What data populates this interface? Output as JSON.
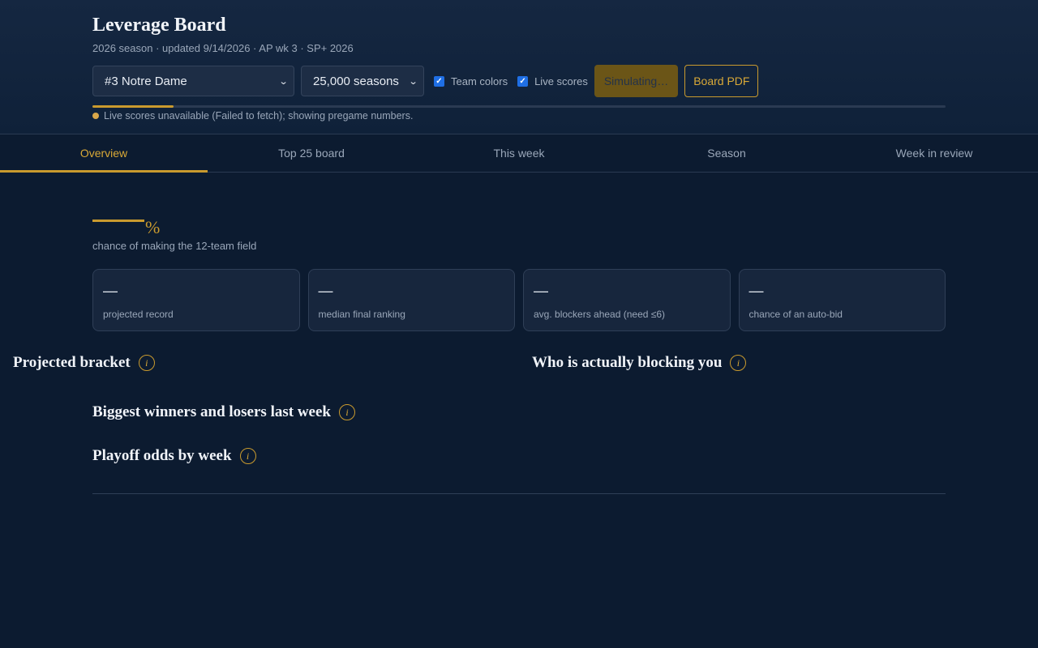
{
  "header": {
    "title": "Leverage Board",
    "subtitle": "2026 season · updated 9/14/2026 · AP wk 3 · SP+ 2026"
  },
  "controls": {
    "team_select": "#3 Notre Dame",
    "seasons_select": "25,000 seasons",
    "team_colors_label": "Team colors",
    "team_colors_checked": true,
    "live_scores_label": "Live scores",
    "live_scores_checked": true,
    "simulate_label": "Simulating…",
    "pdf_label": "Board PDF",
    "progress_fraction": 0.095
  },
  "status": {
    "message": "Live scores unavailable (Failed to fetch); showing pregame numbers."
  },
  "tabs": [
    {
      "label": "Overview",
      "active": true
    },
    {
      "label": "Top 25 board",
      "active": false
    },
    {
      "label": "This week",
      "active": false
    },
    {
      "label": "Season",
      "active": false
    },
    {
      "label": "Week in review",
      "active": false
    }
  ],
  "headline": {
    "value": "",
    "unit": "%",
    "caption": "chance of making the 12-team field"
  },
  "cards": [
    {
      "value": "—",
      "label": "projected record"
    },
    {
      "value": "—",
      "label": "median final ranking"
    },
    {
      "value": "—",
      "label": "avg. blockers ahead (need ≤6)"
    },
    {
      "value": "—",
      "label": "chance of an auto-bid"
    }
  ],
  "sections": {
    "bracket": "Projected bracket",
    "blocking": "Who is actually blocking you",
    "movers": "Biggest winners and losers last week",
    "odds": "Playoff odds by week",
    "info_glyph": "i"
  },
  "colors": {
    "accent": "#c99a2e",
    "background": "#0c1b30",
    "card": "#17263d"
  }
}
